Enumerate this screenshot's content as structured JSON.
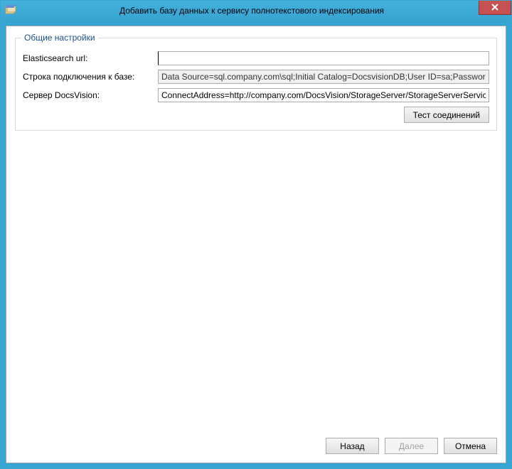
{
  "window": {
    "title": "Добавить базу данных к сервису полнотекстового индексирования"
  },
  "group": {
    "legend": "Общие настройки",
    "fields": {
      "elasticsearch": {
        "label": "Elasticsearch url:",
        "value": ""
      },
      "connection_string": {
        "label": "Строка подключения к базе:",
        "value": "Data Source=sql.company.com\\sql;Initial Catalog=DocsvisionDB;User ID=sa;Password=****"
      },
      "docsvision_server": {
        "label": "Сервер DocsVision:",
        "value": "ConnectAddress=http://company.com/DocsVision/StorageServer/StorageServerService.asmx"
      }
    },
    "test_button": "Тест соединений"
  },
  "footer": {
    "back": "Назад",
    "next": "Далее",
    "cancel": "Отмена"
  }
}
